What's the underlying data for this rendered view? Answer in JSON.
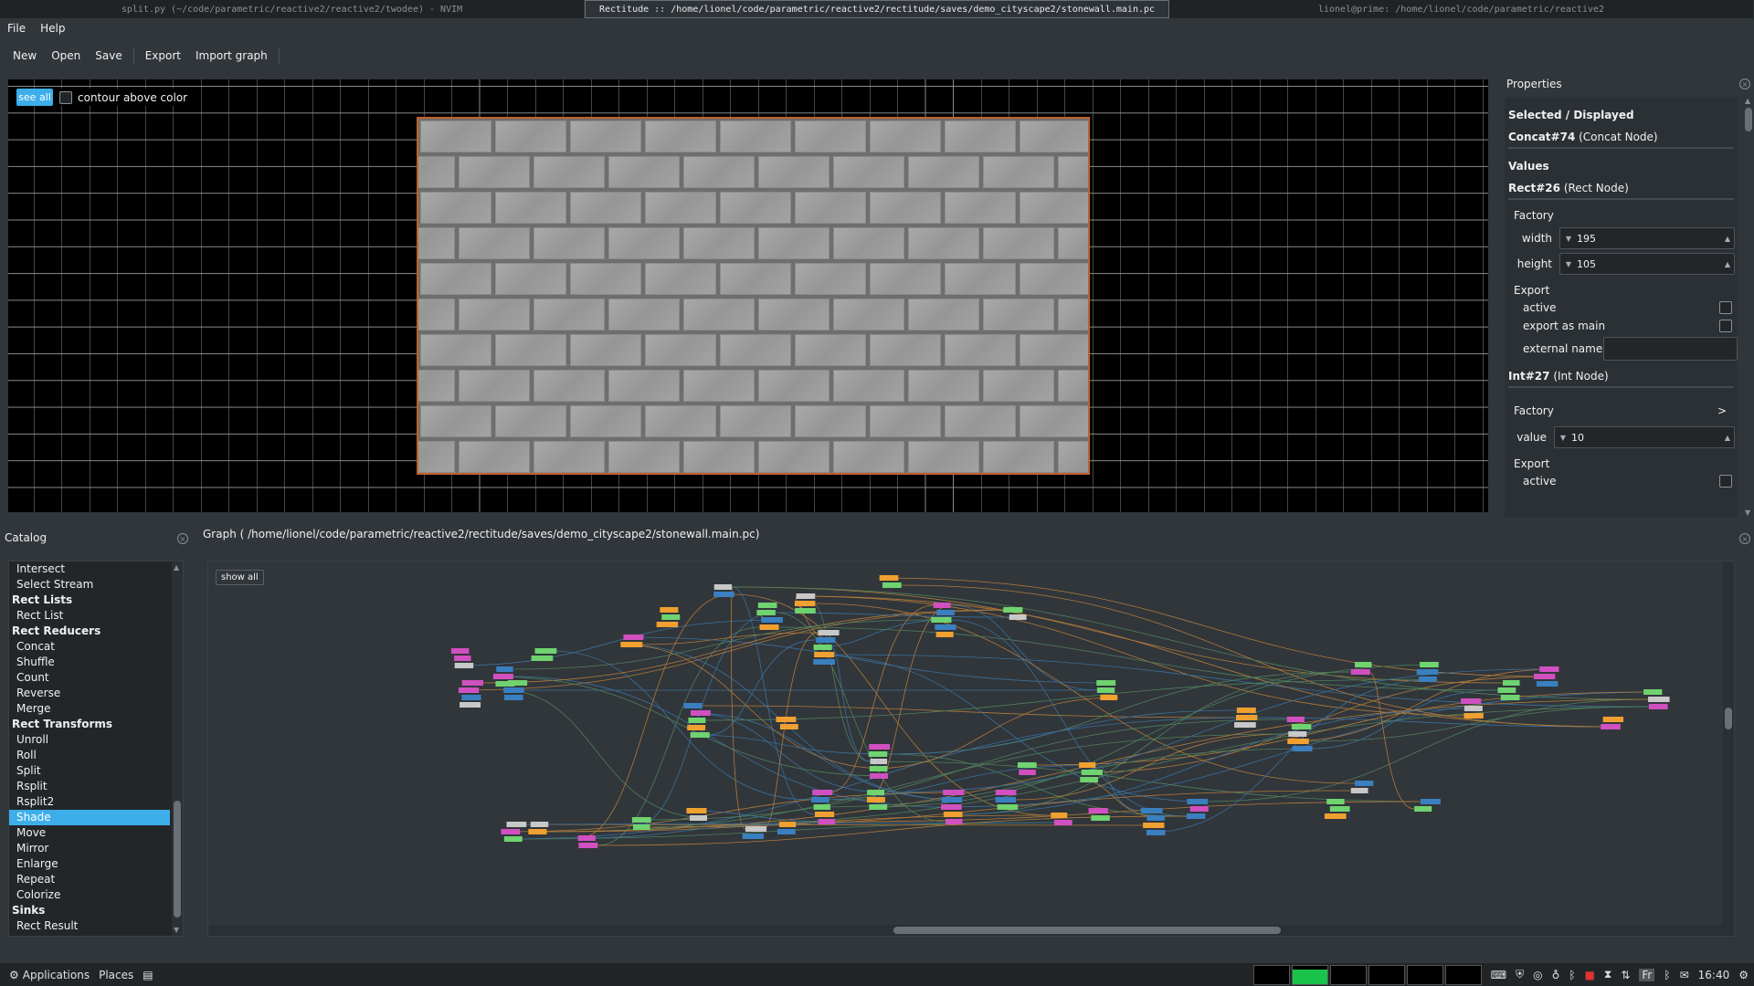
{
  "window_tabs": [
    {
      "title": "split.py (~/code/parametric/reactive2/reactive2/twodee) - NVIM",
      "active": false
    },
    {
      "title": "Rectitude :: /home/lionel/code/parametric/reactive2/rectitude/saves/demo_cityscape2/stonewall.main.pc",
      "active": true
    },
    {
      "title": "lionel@prime: /home/lionel/code/parametric/reactive2",
      "active": false
    }
  ],
  "menu": {
    "file": "File",
    "help": "Help"
  },
  "toolbar": {
    "new": "New",
    "open": "Open",
    "save": "Save",
    "export": "Export",
    "import_graph": "Import graph"
  },
  "viewer": {
    "see_all": "see all",
    "contour_label": "contour above color",
    "contour_checked": false
  },
  "properties": {
    "title": "Properties",
    "selected_header": "Selected / Displayed",
    "selected_node": "Concat#74",
    "selected_type": "(Concat Node)",
    "values_header": "Values",
    "rect_node": "Rect#26",
    "rect_type": "(Rect Node)",
    "factory": "Factory",
    "width_label": "width",
    "width_value": "195",
    "height_label": "height",
    "height_value": "105",
    "export": "Export",
    "active": "active",
    "export_as_main": "export as main",
    "external_name": "external name",
    "int_node": "Int#27",
    "int_type": "(Int Node)",
    "factory2": "Factory",
    "factory2_arrow": ">",
    "value_label": "value",
    "value_value": "10",
    "export2": "Export",
    "active2": "active"
  },
  "catalog": {
    "title": "Catalog",
    "items": [
      {
        "label": "Intersect",
        "head": false
      },
      {
        "label": "Select Stream",
        "head": false
      },
      {
        "label": "Rect Lists",
        "head": true
      },
      {
        "label": "Rect List",
        "head": false
      },
      {
        "label": "Rect Reducers",
        "head": true
      },
      {
        "label": "Concat",
        "head": false
      },
      {
        "label": "Shuffle",
        "head": false
      },
      {
        "label": "Count",
        "head": false
      },
      {
        "label": "Reverse",
        "head": false
      },
      {
        "label": "Merge",
        "head": false
      },
      {
        "label": "Rect Transforms",
        "head": true
      },
      {
        "label": "Unroll",
        "head": false
      },
      {
        "label": "Roll",
        "head": false
      },
      {
        "label": "Split",
        "head": false
      },
      {
        "label": "Rsplit",
        "head": false
      },
      {
        "label": "Rsplit2",
        "head": false
      },
      {
        "label": "Shade",
        "head": false,
        "selected": true
      },
      {
        "label": "Move",
        "head": false
      },
      {
        "label": "Mirror",
        "head": false
      },
      {
        "label": "Enlarge",
        "head": false
      },
      {
        "label": "Repeat",
        "head": false
      },
      {
        "label": "Colorize",
        "head": false
      },
      {
        "label": "Sinks",
        "head": true
      },
      {
        "label": "Rect Result",
        "head": false
      }
    ]
  },
  "graph": {
    "title": "Graph ( /home/lionel/code/parametric/reactive2/rectitude/saves/demo_cityscape2/stonewall.main.pc)",
    "show_all": "show all"
  },
  "taskbar": {
    "applications": "Applications",
    "places": "Places",
    "clock": "16:40",
    "lang": "Fr"
  },
  "colors": {
    "accent": "#3daee9",
    "node_green": "#6fd36f",
    "node_orange": "#f0a030",
    "node_pink": "#d050c0",
    "node_blue": "#3a7fc0",
    "node_grey": "#c8c8c8",
    "wall_border": "#c0622e"
  }
}
